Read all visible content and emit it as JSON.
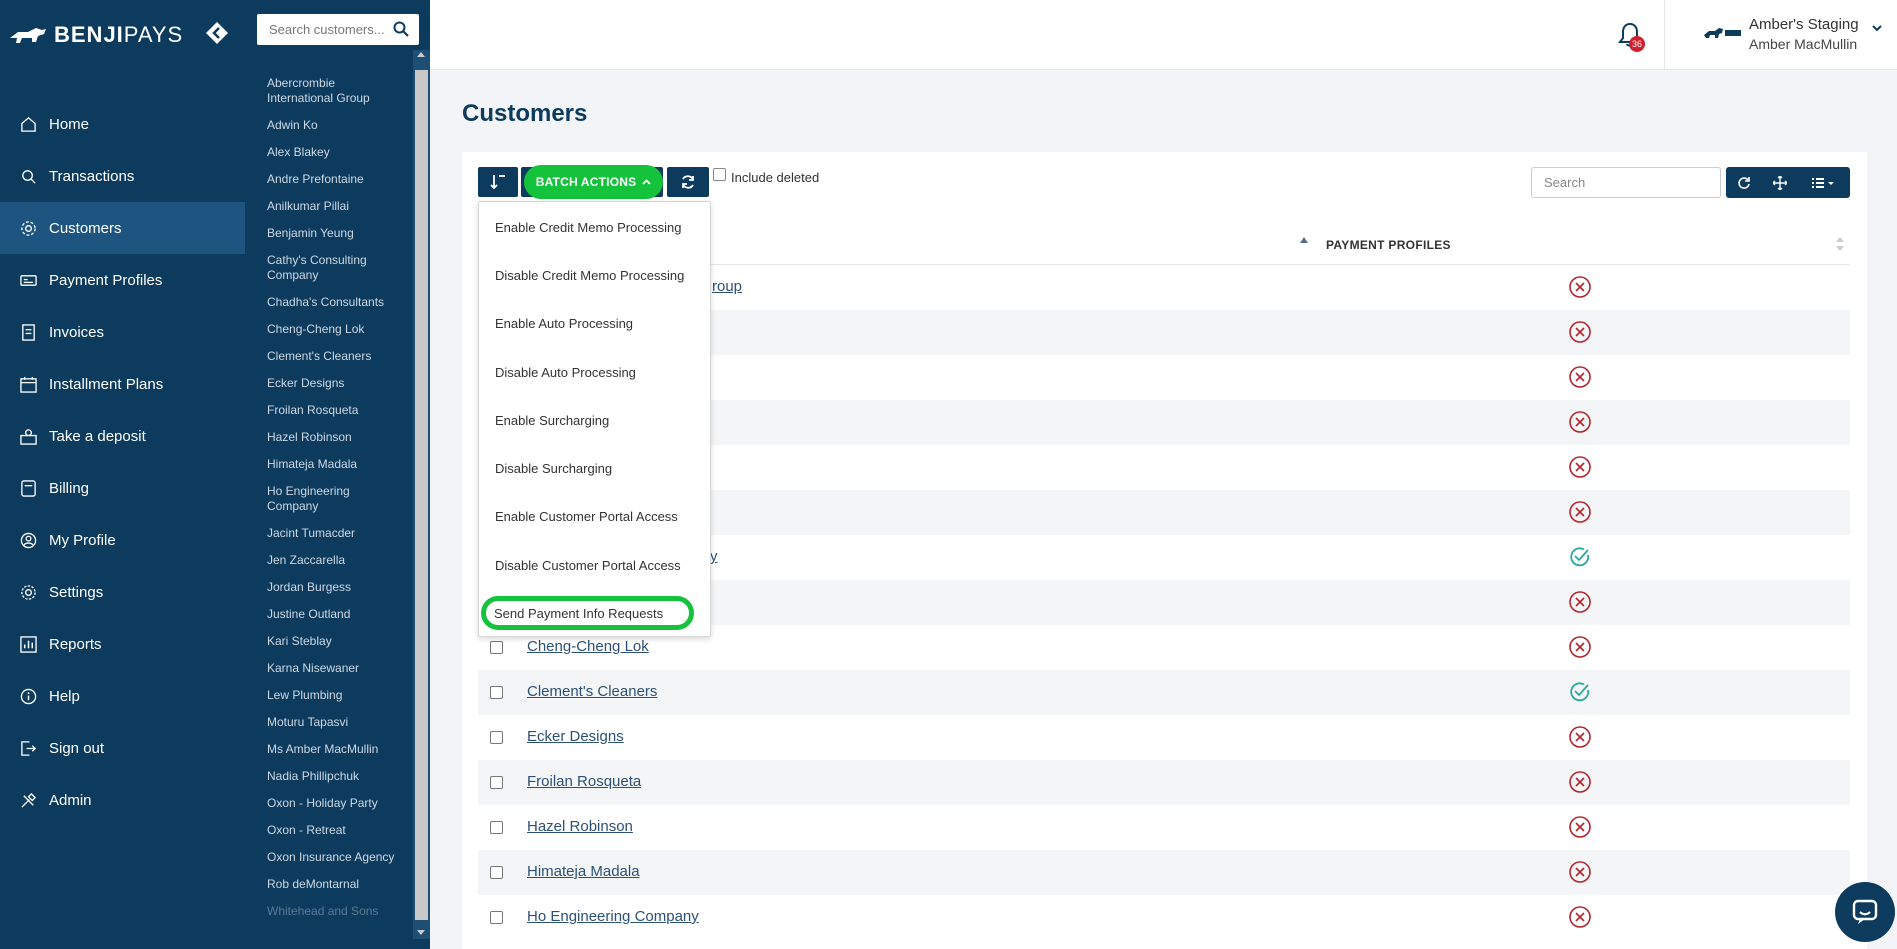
{
  "brand": {
    "name_bold": "BENJI",
    "name_light": "PAYS"
  },
  "nav": {
    "items": [
      {
        "label": "Home",
        "icon": "home-icon"
      },
      {
        "label": "Transactions",
        "icon": "transactions-icon"
      },
      {
        "label": "Customers",
        "icon": "customers-icon",
        "active": true
      },
      {
        "label": "Payment Profiles",
        "icon": "payment-profiles-icon"
      },
      {
        "label": "Invoices",
        "icon": "invoices-icon"
      },
      {
        "label": "Installment Plans",
        "icon": "installment-plans-icon"
      },
      {
        "label": "Take a deposit",
        "icon": "deposit-icon"
      },
      {
        "label": "Billing",
        "icon": "billing-icon"
      },
      {
        "label": "My Profile",
        "icon": "profile-icon"
      },
      {
        "label": "Settings",
        "icon": "settings-icon"
      },
      {
        "label": "Reports",
        "icon": "reports-icon"
      },
      {
        "label": "Help",
        "icon": "help-icon"
      },
      {
        "label": "Sign out",
        "icon": "sign-out-icon"
      },
      {
        "label": "Admin",
        "icon": "admin-icon"
      }
    ]
  },
  "customer_panel": {
    "search_placeholder": "Search customers...",
    "customers": [
      "Abercrombie International Group",
      "Adwin Ko",
      "Alex Blakey",
      "Andre Prefontaine",
      "Anilkumar Pillai",
      "Benjamin Yeung",
      "Cathy's Consulting Company",
      "Chadha's Consultants",
      "Cheng-Cheng Lok",
      "Clement's Cleaners",
      "Ecker Designs",
      "Froilan Rosqueta",
      "Hazel Robinson",
      "Himateja Madala",
      "Ho Engineering Company",
      "Jacint Tumacder",
      "Jen Zaccarella",
      "Jordan Burgess",
      "Justine Outland",
      "Kari Steblay",
      "Karna Nisewaner",
      "Lew Plumbing",
      "Moturu Tapasvi",
      "Ms Amber MacMullin",
      "Nadia Phillipchuk",
      "Oxon - Holiday Party",
      "Oxon - Retreat",
      "Oxon Insurance Agency",
      "Rob deMontarnal",
      "Whitehead and Sons"
    ]
  },
  "header": {
    "notification_count": "36",
    "account_name": "Amber's Staging",
    "account_user": "Amber MacMullin"
  },
  "page": {
    "title": "Customers",
    "batch_actions_label": "BATCH ACTIONS",
    "include_deleted_label": "Include deleted",
    "search_placeholder": "Search",
    "column_payment_profiles": "PAYMENT PROFILES"
  },
  "batch_menu": {
    "items": [
      "Enable Credit Memo Processing",
      "Disable Credit Memo Processing",
      "Enable Auto Processing",
      "Disable Auto Processing",
      "Enable Surcharging",
      "Disable Surcharging",
      "Enable Customer Portal Access",
      "Disable Customer Portal Access",
      "Send Payment Info Requests"
    ]
  },
  "table": {
    "rows": [
      {
        "name": "Abercrombie International Group",
        "visible_fragment": "roup",
        "status": "none"
      },
      {
        "name": "",
        "visible_fragment": "",
        "status": "none"
      },
      {
        "name": "",
        "visible_fragment": "",
        "status": "none"
      },
      {
        "name": "",
        "visible_fragment": "",
        "status": "none"
      },
      {
        "name": "",
        "visible_fragment": "",
        "status": "none"
      },
      {
        "name": "",
        "visible_fragment": "",
        "status": "none"
      },
      {
        "name": "Cathy's Consulting Company",
        "visible_fragment": "y",
        "status": "ok"
      },
      {
        "name": "",
        "visible_fragment": "",
        "status": "none"
      },
      {
        "name": "Cheng-Cheng Lok",
        "visible_fragment": "",
        "status": "none"
      },
      {
        "name": "Clement's Cleaners",
        "visible_fragment": "",
        "status": "ok"
      },
      {
        "name": "Ecker Designs",
        "visible_fragment": "",
        "status": "none"
      },
      {
        "name": "Froilan Rosqueta",
        "visible_fragment": "",
        "status": "none"
      },
      {
        "name": "Hazel Robinson",
        "visible_fragment": "",
        "status": "none"
      },
      {
        "name": "Himateja Madala",
        "visible_fragment": "",
        "status": "none"
      },
      {
        "name": "Ho Engineering Company",
        "visible_fragment": "",
        "status": "none"
      }
    ]
  },
  "colors": {
    "nav_bg": "#0d3b5e",
    "nav_active": "#1d5580",
    "highlight_green": "#15c23b",
    "error_red": "#b3262e",
    "ok_teal": "#27a9a0"
  }
}
